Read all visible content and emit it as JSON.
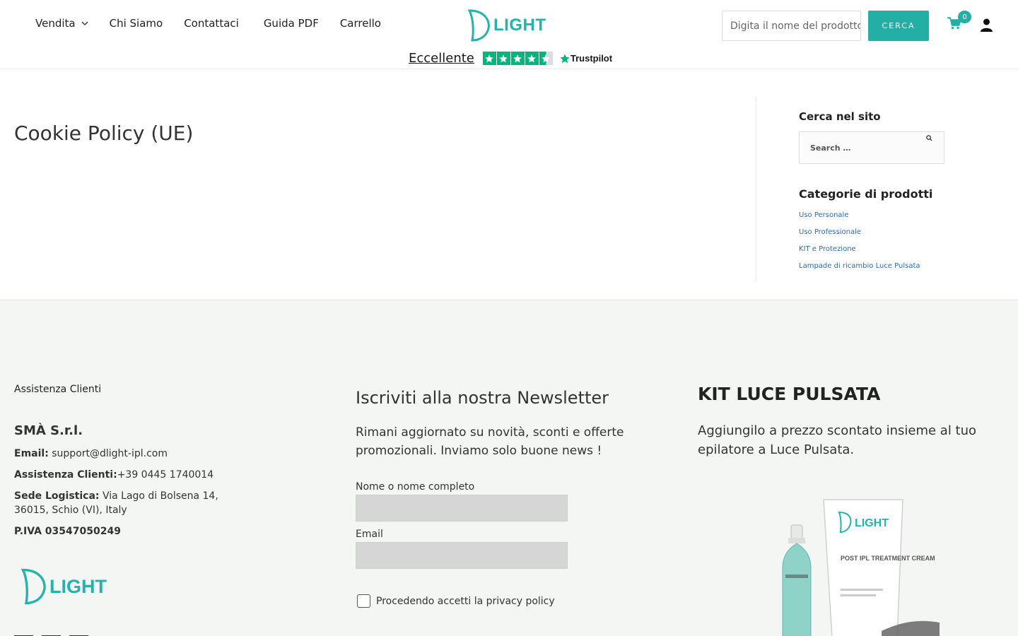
{
  "header": {
    "nav": [
      {
        "label": "Vendita",
        "has_dropdown": true
      },
      {
        "label": "Chi Siamo"
      },
      {
        "label": "Contattaci"
      },
      {
        "label": "Guida PDF"
      },
      {
        "label": "Carrello"
      }
    ],
    "logo_text": "LIGHT",
    "trustpilot": {
      "label": "Eccellente",
      "brand": "Trustpilot",
      "rating_stars": 4.5
    },
    "search": {
      "placeholder": "Digita il nome del prodotto"
    },
    "search_button": "CERCA",
    "cart_count": "0",
    "accent_color": "#23aea6"
  },
  "main": {
    "title": "Cookie Policy (UE)"
  },
  "sidebar": {
    "search_heading": "Cerca nel sito",
    "search_placeholder": "Search …",
    "categories_heading": "Categorie di prodotti",
    "categories": [
      "Uso Personale",
      "Uso Professionale",
      "KIT e Protezione",
      "Lampade di ricambio Luce Pulsata"
    ]
  },
  "footer": {
    "assistance": "Assistenza Clienti",
    "company": "SMÀ S.r.l.",
    "email_label": "Email:",
    "email": "support@dlight-ipl.com",
    "phone_label": "Assistenza Clienti:",
    "phone": "+39 0445 1740014",
    "address_label": "Sede Logistica:",
    "address": "Via Lago di Bolsena 14, 36015, Schio (VI), Italy",
    "vat": "P.IVA 03547050249",
    "logo_text": "LIGHT",
    "newsletter": {
      "title": "Iscriviti alla nostra Newsletter",
      "description": "Rimani aggiornato su novità, sconti e offerte promozionali. Inviamo solo buone news !",
      "name_label": "Nome o nome completo",
      "email_label": "Email",
      "privacy_label": "Procedendo accetti la privacy policy"
    },
    "kit": {
      "title": "KIT LUCE PULSATA",
      "description": "Aggiungilo a prezzo scontato insieme al tuo epilatore a Luce Pulsata.",
      "product_brand": "LIGHT",
      "product_text": "POST IPL TREATMENT CREAM"
    }
  }
}
